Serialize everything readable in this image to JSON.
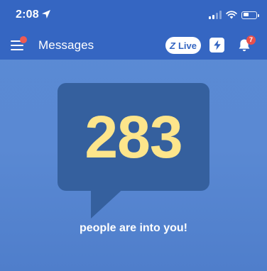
{
  "status_bar": {
    "time": "2:08",
    "location_icon": "location-arrow-icon",
    "battery_level": 0.45
  },
  "navbar": {
    "title": "Messages",
    "menu_icon": "hamburger-menu-icon",
    "menu_has_notification_dot": true,
    "live_button": {
      "logo": "Z",
      "label": "Live"
    },
    "boost_icon": "lightning-bolt-icon",
    "notifications": {
      "icon": "bell-icon",
      "badge_count": "7"
    }
  },
  "main": {
    "count": "283",
    "tagline": "people are into you!"
  },
  "colors": {
    "topbar": "#3566c2",
    "background": "#5a89d3",
    "bubble": "#35609e",
    "count_text": "#fde58b",
    "badge": "#e8504c"
  }
}
